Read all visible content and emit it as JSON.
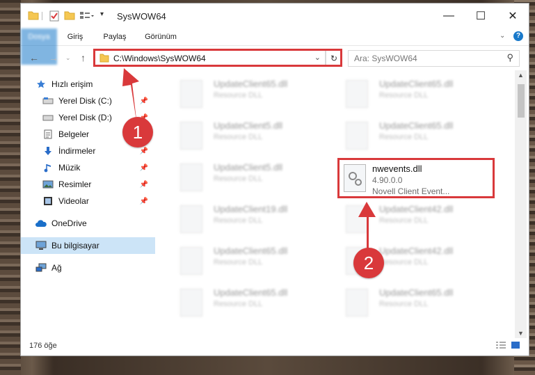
{
  "window": {
    "title": "SysWOW64"
  },
  "ribbon": {
    "tabs": [
      "Dosya",
      "Giriş",
      "Paylaş",
      "Görünüm"
    ]
  },
  "address": {
    "path": "C:\\Windows\\SysWOW64"
  },
  "search": {
    "placeholder": "Ara: SysWOW64"
  },
  "sidebar": {
    "items": [
      {
        "label": "Hızlı erişim",
        "icon": "star-icon"
      },
      {
        "label": "Yerel Disk (C:)",
        "icon": "drive-icon",
        "pinned": true
      },
      {
        "label": "Yerel Disk (D:)",
        "icon": "drive-icon",
        "pinned": true
      },
      {
        "label": "Belgeler",
        "icon": "document-icon",
        "pinned": true
      },
      {
        "label": "İndirmeler",
        "icon": "download-icon",
        "pinned": true
      },
      {
        "label": "Müzik",
        "icon": "music-icon",
        "pinned": true
      },
      {
        "label": "Resimler",
        "icon": "picture-icon",
        "pinned": true
      },
      {
        "label": "Videolar",
        "icon": "video-icon",
        "pinned": true
      },
      {
        "label": "OneDrive",
        "icon": "cloud-icon"
      },
      {
        "label": "Bu bilgisayar",
        "icon": "computer-icon",
        "selected": true
      },
      {
        "label": "Ağ",
        "icon": "network-icon"
      }
    ]
  },
  "files": [
    {
      "name": "UpdateClient65.dll",
      "type": "Resource DLL"
    },
    {
      "name": "UpdateClient65.dll",
      "type": "Resource DLL"
    },
    {
      "name": "UpdateClient5.dll",
      "type": "Resource DLL"
    },
    {
      "name": "UpdateClient65.dll",
      "type": "Resource DLL"
    },
    {
      "name": "UpdateClient5.dll",
      "type": "Resource DLL"
    },
    {
      "name": "UpdateClient19.dll",
      "type": "Resource DLL"
    },
    {
      "name": "UpdateClient42.dll",
      "type": "Resource DLL"
    },
    {
      "name": "UpdateClient65.dll",
      "type": "Resource DLL"
    },
    {
      "name": "UpdateClient42.dll",
      "type": "Resource DLL"
    },
    {
      "name": "UpdateClient65.dll",
      "type": "Resource DLL"
    },
    {
      "name": "UpdateClient65.dll",
      "type": "Resource DLL"
    }
  ],
  "highlighted_file": {
    "name": "nwevents.dll",
    "version": "4.90.0.0",
    "description": "Novell Client Event..."
  },
  "status": {
    "count": "176 öğe"
  },
  "annotations": {
    "step1": "1",
    "step2": "2",
    "color": "#d9393b"
  }
}
